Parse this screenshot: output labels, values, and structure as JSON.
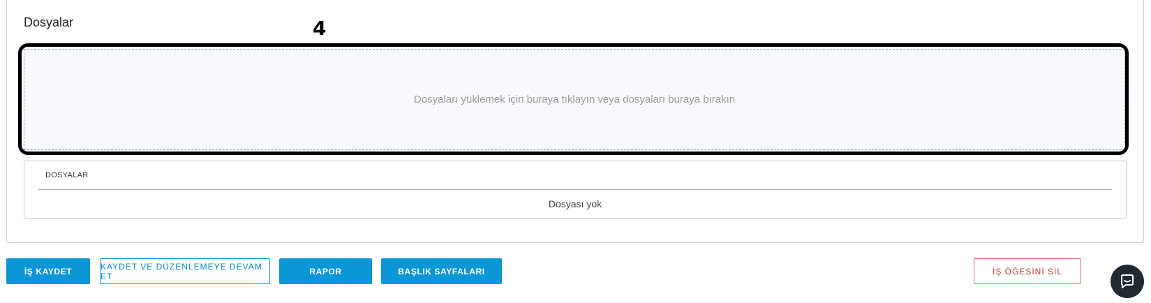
{
  "files_section": {
    "title": "Dosyalar",
    "annotation_number": "4",
    "dropzone_text": "Dosyaları yüklemek için buraya tıklayın veya dosyaları buraya bırakın",
    "table_header": "DOSYALAR",
    "empty_text": "Dosyası yok"
  },
  "actions": {
    "save": "İŞ KAYDET",
    "save_continue": "KAYDET VE DÜZENLEMEYE DEVAM ET",
    "report": "RAPOR",
    "title_pages": "BAŞLIK SAYFALARI",
    "delete": "İŞ ÖĞESİNİ SİL"
  },
  "chat": {
    "icon": "chat-bubble-icon"
  },
  "colors": {
    "primary": "#0b96d6",
    "danger": "#c0392b",
    "dropzone_bg": "#f7f9fc",
    "chat_bg": "#1f2a33"
  }
}
